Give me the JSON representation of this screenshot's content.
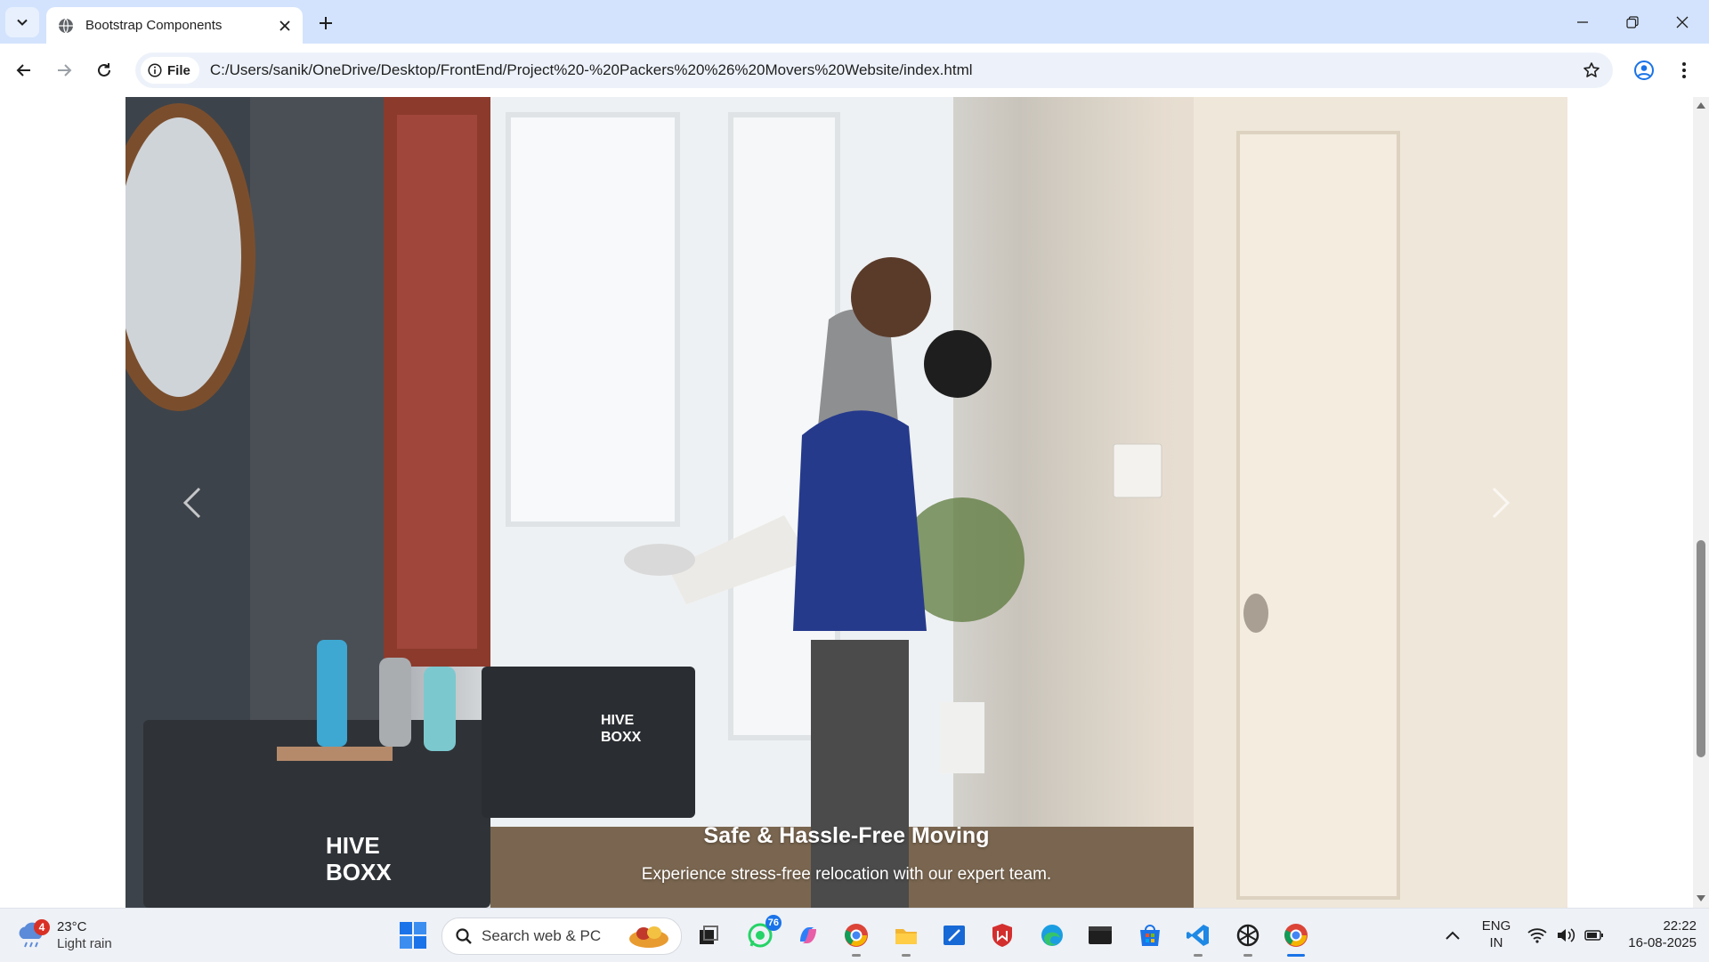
{
  "browser": {
    "tab_title": "Bootstrap Components",
    "site_chip": "File",
    "url": "C:/Users/sanik/OneDrive/Desktop/FrontEnd/Project%20-%20Packers%20%26%20Movers%20Website/index.html"
  },
  "carousel": {
    "caption_title": "Safe & Hassle-Free Moving",
    "caption_text": "Experience stress-free relocation with our expert team.",
    "box_brand_line1": "HIVE",
    "box_brand_line2": "BOXX"
  },
  "taskbar": {
    "weather_badge": "4",
    "weather_temp": "23°C",
    "weather_condition": "Light rain",
    "search_label": "Search web & PC",
    "whatsapp_count": "76",
    "language_line1": "ENG",
    "language_line2": "IN",
    "time": "22:22",
    "date": "16-08-2025"
  },
  "colors": {
    "titlebar": "#d3e3fd",
    "accent": "#1a73e8",
    "omnibox": "#edf2fa"
  }
}
